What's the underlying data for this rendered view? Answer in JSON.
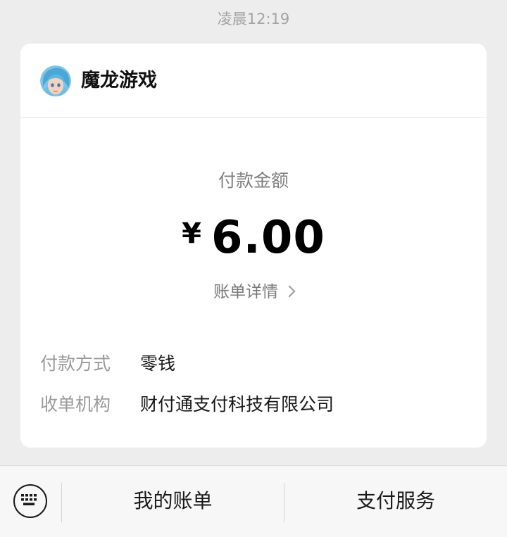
{
  "timestamp": "凌晨12:19",
  "card": {
    "merchant": {
      "name": "魔龙游戏",
      "avatar_icon": "game-character-avatar-icon"
    },
    "amount_label": "付款金额",
    "currency_symbol": "¥",
    "amount_value": "6.00",
    "bill_detail_label": "账单详情",
    "details": [
      {
        "key": "付款方式",
        "value": "零钱"
      },
      {
        "key": "收单机构",
        "value": "财付通支付科技有限公司"
      }
    ]
  },
  "bottom_bar": {
    "keyboard_icon": "keyboard-icon",
    "items": [
      {
        "label": "我的账单"
      },
      {
        "label": "支付服务"
      }
    ]
  },
  "colors": {
    "background": "#ededed",
    "card": "#ffffff",
    "muted_text": "#9a9a9a",
    "primary_text": "#111111"
  }
}
